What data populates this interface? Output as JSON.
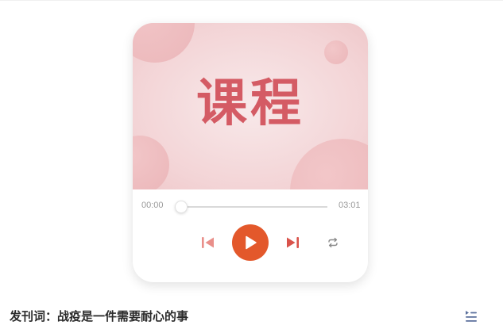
{
  "colors": {
    "accent": "#e3582b",
    "cover_text": "#d45b64",
    "skip_icon": "#e98f8a",
    "loop_icon": "#8a8a8a",
    "playlist_icon": "#5a6f9c"
  },
  "cover": {
    "title": "课程"
  },
  "player": {
    "current_time": "00:00",
    "total_time": "03:01",
    "progress": 0,
    "icons": {
      "previous": "skip-previous-icon",
      "play": "play-icon",
      "next": "skip-next-icon",
      "loop": "loop-icon"
    }
  },
  "episode": {
    "title": "发刊词：战疫是一件需要耐心的事",
    "playlist_icon": "playlist-icon"
  }
}
